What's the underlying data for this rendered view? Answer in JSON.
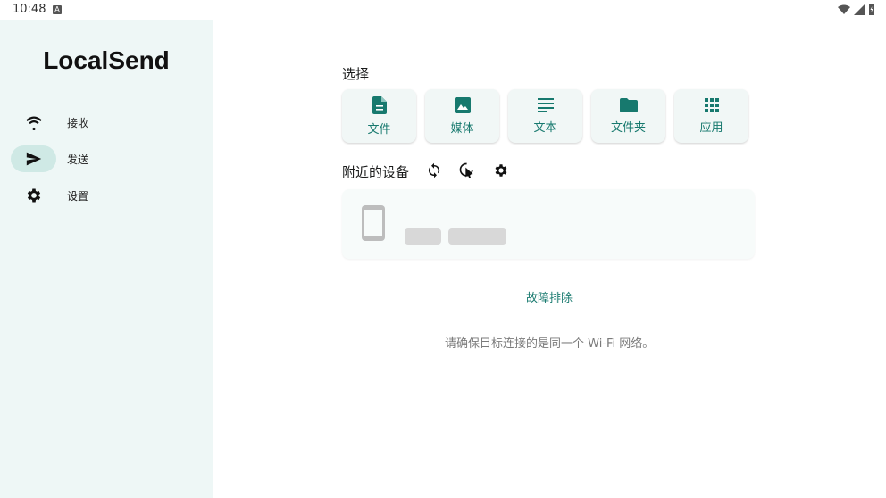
{
  "status_bar": {
    "time": "10:48",
    "badge": "A"
  },
  "sidebar": {
    "title": "LocalSend",
    "items": [
      {
        "label": "接收",
        "icon": "wifi-icon",
        "active": false
      },
      {
        "label": "发送",
        "icon": "send-icon",
        "active": true
      },
      {
        "label": "设置",
        "icon": "gear-icon",
        "active": false
      }
    ]
  },
  "main": {
    "select_label": "选择",
    "cards": [
      {
        "label": "文件",
        "icon": "file-icon"
      },
      {
        "label": "媒体",
        "icon": "image-icon"
      },
      {
        "label": "文本",
        "icon": "text-icon"
      },
      {
        "label": "文件夹",
        "icon": "folder-icon"
      },
      {
        "label": "应用",
        "icon": "apps-grid-icon"
      }
    ],
    "nearby_label": "附近的设备",
    "troubleshoot_label": "故障排除",
    "hint": "请确保目标连接的是同一个 Wi-Fi 网络。"
  },
  "colors": {
    "accent": "#17796e",
    "sidebar_bg": "#eef7f6",
    "active_pill": "#cfe9e5"
  }
}
